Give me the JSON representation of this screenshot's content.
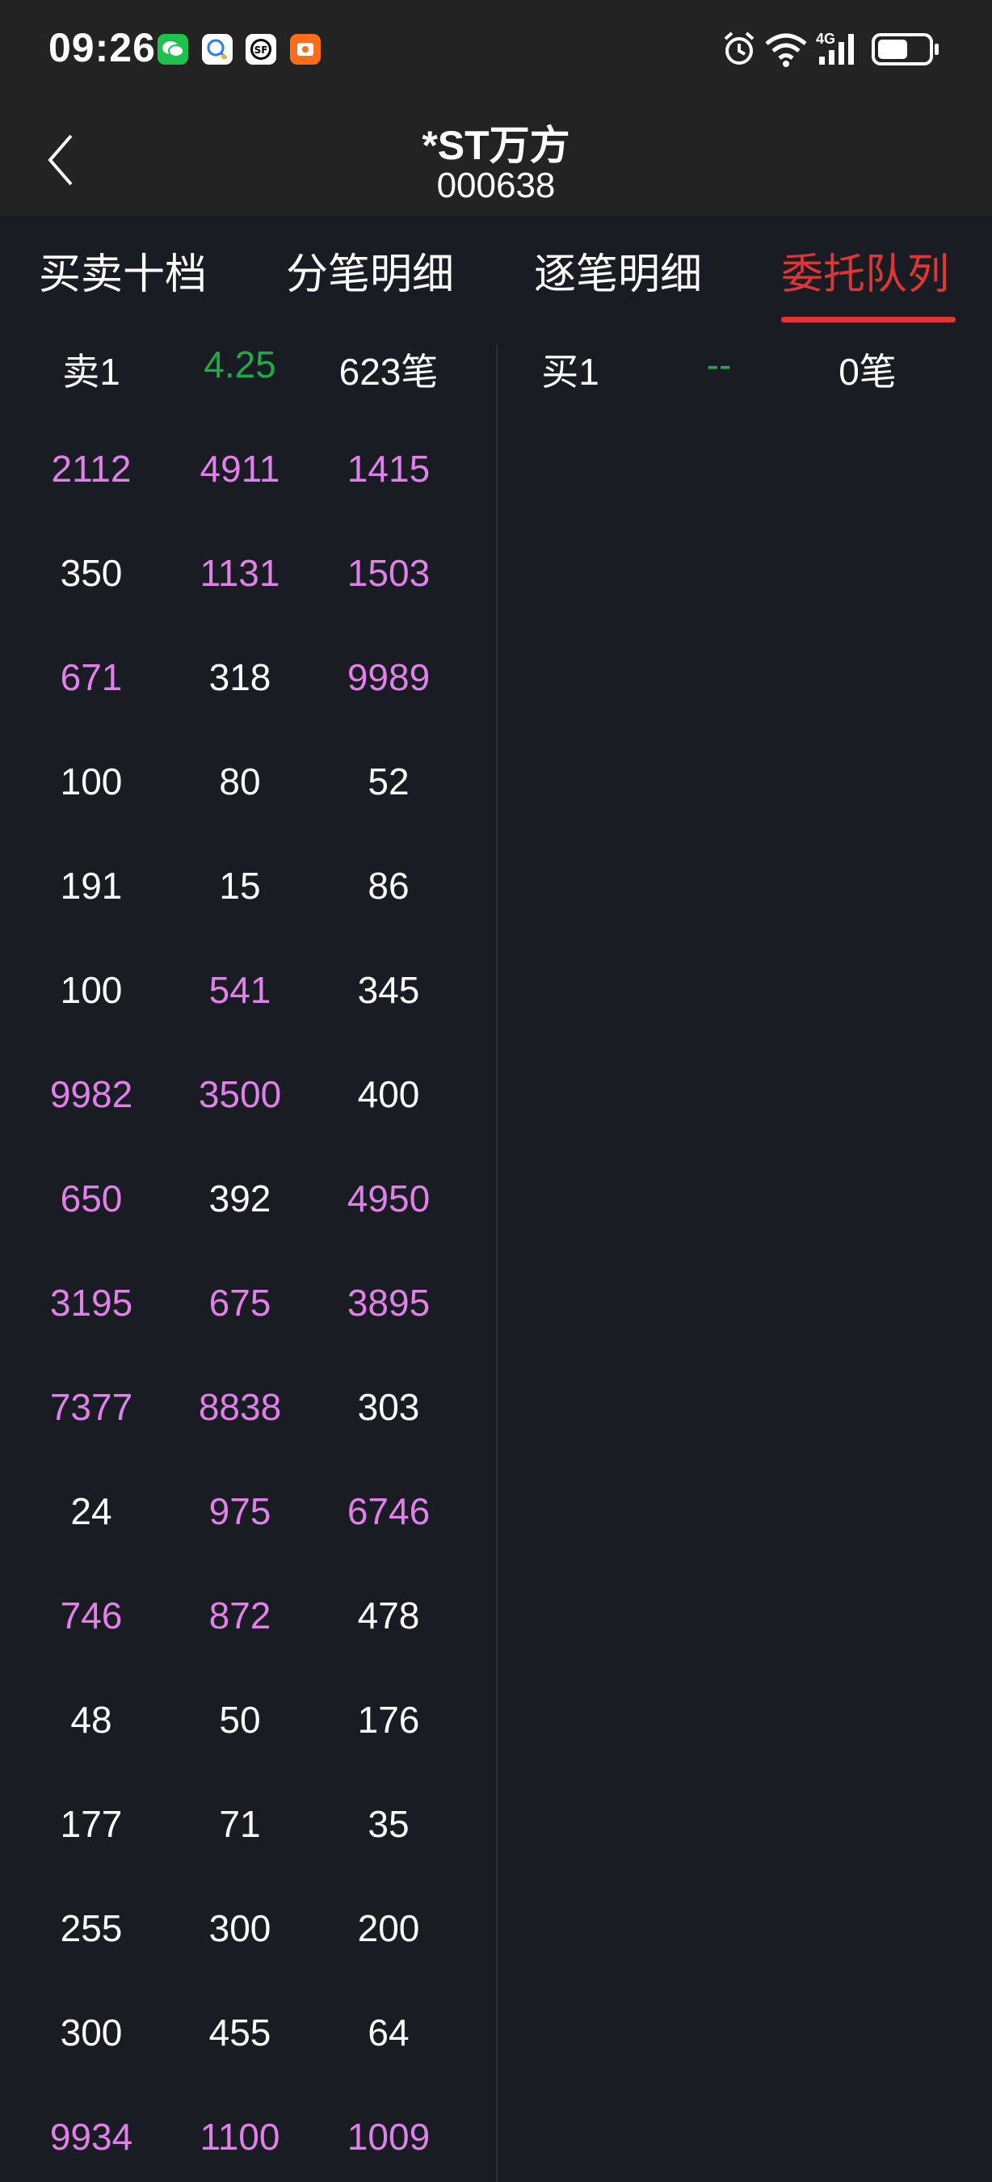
{
  "status_bar": {
    "time": "09:26",
    "apps": [
      {
        "icon": "wechat-icon",
        "color": "#1fc24f"
      },
      {
        "icon": "qq-icon",
        "color": "#ffffff"
      },
      {
        "icon": "sf-express-icon",
        "color": "#ffffff"
      },
      {
        "icon": "taobao-icon",
        "color": "#ff6d1b"
      }
    ],
    "network": "4G",
    "battery_level": 0.6
  },
  "header": {
    "title": "*ST万方",
    "code": "000638"
  },
  "tabs": [
    {
      "label": "买卖十档",
      "active": false
    },
    {
      "label": "分笔明细",
      "active": false
    },
    {
      "label": "逐笔明细",
      "active": false
    },
    {
      "label": "委托队列",
      "active": true
    }
  ],
  "sell_queue": {
    "header": {
      "label": "卖1",
      "price": "4.25",
      "count": "623笔"
    },
    "rows": [
      [
        {
          "v": "2112",
          "hl": true
        },
        {
          "v": "4911",
          "hl": true
        },
        {
          "v": "1415",
          "hl": true
        }
      ],
      [
        {
          "v": "350",
          "hl": false
        },
        {
          "v": "1131",
          "hl": true
        },
        {
          "v": "1503",
          "hl": true
        }
      ],
      [
        {
          "v": "671",
          "hl": true
        },
        {
          "v": "318",
          "hl": false
        },
        {
          "v": "9989",
          "hl": true
        }
      ],
      [
        {
          "v": "100",
          "hl": false
        },
        {
          "v": "80",
          "hl": false
        },
        {
          "v": "52",
          "hl": false
        }
      ],
      [
        {
          "v": "191",
          "hl": false
        },
        {
          "v": "15",
          "hl": false
        },
        {
          "v": "86",
          "hl": false
        }
      ],
      [
        {
          "v": "100",
          "hl": false
        },
        {
          "v": "541",
          "hl": true
        },
        {
          "v": "345",
          "hl": false
        }
      ],
      [
        {
          "v": "9982",
          "hl": true
        },
        {
          "v": "3500",
          "hl": true
        },
        {
          "v": "400",
          "hl": false
        }
      ],
      [
        {
          "v": "650",
          "hl": true
        },
        {
          "v": "392",
          "hl": false
        },
        {
          "v": "4950",
          "hl": true
        }
      ],
      [
        {
          "v": "3195",
          "hl": true
        },
        {
          "v": "675",
          "hl": true
        },
        {
          "v": "3895",
          "hl": true
        }
      ],
      [
        {
          "v": "7377",
          "hl": true
        },
        {
          "v": "8838",
          "hl": true
        },
        {
          "v": "303",
          "hl": false
        }
      ],
      [
        {
          "v": "24",
          "hl": false
        },
        {
          "v": "975",
          "hl": true
        },
        {
          "v": "6746",
          "hl": true
        }
      ],
      [
        {
          "v": "746",
          "hl": true
        },
        {
          "v": "872",
          "hl": true
        },
        {
          "v": "478",
          "hl": false
        }
      ],
      [
        {
          "v": "48",
          "hl": false
        },
        {
          "v": "50",
          "hl": false
        },
        {
          "v": "176",
          "hl": false
        }
      ],
      [
        {
          "v": "177",
          "hl": false
        },
        {
          "v": "71",
          "hl": false
        },
        {
          "v": "35",
          "hl": false
        }
      ],
      [
        {
          "v": "255",
          "hl": false
        },
        {
          "v": "300",
          "hl": false
        },
        {
          "v": "200",
          "hl": false
        }
      ],
      [
        {
          "v": "300",
          "hl": false
        },
        {
          "v": "455",
          "hl": false
        },
        {
          "v": "64",
          "hl": false
        }
      ],
      [
        {
          "v": "9934",
          "hl": true
        },
        {
          "v": "1100",
          "hl": true
        },
        {
          "v": "1009",
          "hl": true
        }
      ]
    ]
  },
  "buy_queue": {
    "header": {
      "label": "买1",
      "price": "--",
      "count": "0笔"
    },
    "rows": []
  },
  "colors": {
    "background": "#1a1c24",
    "bar": "#232323",
    "accent_red": "#e03535",
    "highlight_pink": "#e080e8",
    "price_green": "#1faa4a"
  }
}
